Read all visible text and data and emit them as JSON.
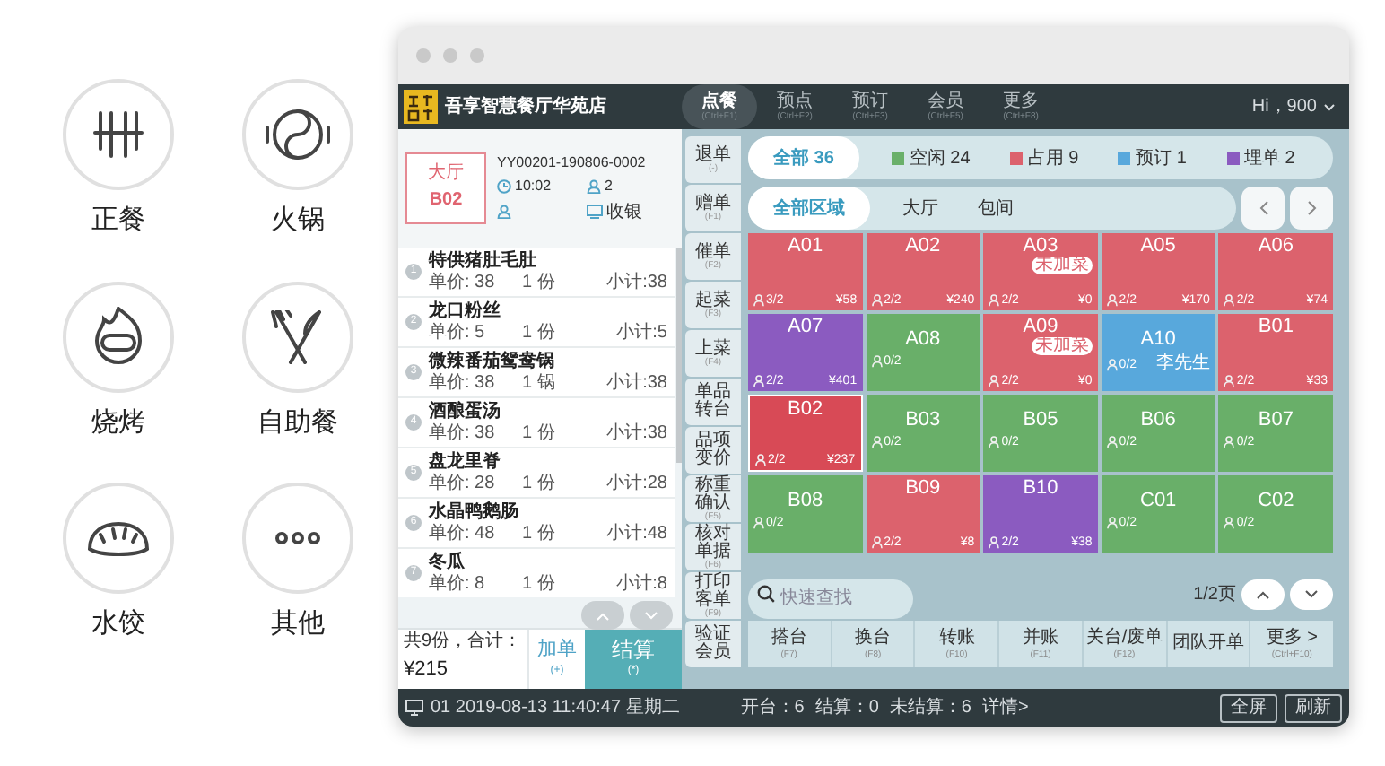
{
  "categories": [
    {
      "label": "正餐"
    },
    {
      "label": "火锅"
    },
    {
      "label": "烧烤"
    },
    {
      "label": "自助餐"
    },
    {
      "label": "水饺"
    },
    {
      "label": "其他"
    }
  ],
  "app": {
    "store_name": "吾享智慧餐厅华苑店",
    "nav": [
      {
        "label": "点餐",
        "shortcut": "(Ctrl+F1)",
        "selected": true
      },
      {
        "label": "预点",
        "shortcut": "(Ctrl+F2)",
        "selected": false
      },
      {
        "label": "预订",
        "shortcut": "(Ctrl+F3)",
        "selected": false
      },
      {
        "label": "会员",
        "shortcut": "(Ctrl+F5)",
        "selected": false
      },
      {
        "label": "更多",
        "shortcut": "(Ctrl+F8)",
        "selected": false
      }
    ],
    "user": "Hi，900",
    "order": {
      "area": "大厅",
      "table": "B02",
      "number": "YY00201-190806-0002",
      "time": "10:02",
      "guests": "2",
      "role": "收银",
      "items": [
        {
          "index": "1",
          "name": "特供猪肚毛肚",
          "price": "单价: 38",
          "qty": "1 份",
          "subtotal": "小计:38"
        },
        {
          "index": "2",
          "name": "龙口粉丝",
          "price": "单价: 5",
          "qty": "1 份",
          "subtotal": "小计:5"
        },
        {
          "index": "3",
          "name": "微辣番茄鸳鸯锅",
          "price": "单价: 38",
          "qty": "1 锅",
          "subtotal": "小计:38"
        },
        {
          "index": "4",
          "name": "酒酿蛋汤",
          "price": "单价: 38",
          "qty": "1 份",
          "subtotal": "小计:38"
        },
        {
          "index": "5",
          "name": "盘龙里脊",
          "price": "单价: 28",
          "qty": "1 份",
          "subtotal": "小计:28"
        },
        {
          "index": "6",
          "name": "水晶鸭鹅肠",
          "price": "单价: 48",
          "qty": "1 份",
          "subtotal": "小计:48"
        },
        {
          "index": "7",
          "name": "冬瓜",
          "price": "单价: 8",
          "qty": "1 份",
          "subtotal": "小计:8"
        }
      ],
      "summary_label": "共9份，合计：",
      "total": "¥215",
      "add_button": {
        "label": "加单",
        "key": "(+)"
      },
      "checkout_button": {
        "label": "结算",
        "key": "(*)"
      }
    },
    "side_buttons": [
      {
        "label": "退单",
        "key": "(-)"
      },
      {
        "label": "赠单",
        "key": "(F1)"
      },
      {
        "label": "催单",
        "key": "(F2)"
      },
      {
        "label": "起菜",
        "key": "(F3)"
      },
      {
        "label": "上菜",
        "key": "(F4)"
      },
      {
        "label": "单品转台"
      },
      {
        "label": "品项变价"
      },
      {
        "label": "称重确认",
        "key": "(F5)"
      },
      {
        "label": "核对单据",
        "key": "(F6)"
      },
      {
        "label": "打印客单",
        "key": "(F9)"
      },
      {
        "label": "验证会员"
      }
    ],
    "status_filters": [
      {
        "label": "全部 36",
        "selected": true
      },
      {
        "label": "空闲 24",
        "color": "#6ab06a",
        "selected": false
      },
      {
        "label": "占用 9",
        "color": "#dc626d",
        "selected": false
      },
      {
        "label": "预订 1",
        "color": "#58a8dc",
        "selected": false
      },
      {
        "label": "埋单 2",
        "color": "#8b5bc0",
        "selected": false
      }
    ],
    "area_filters": [
      {
        "label": "全部区域",
        "selected": true
      },
      {
        "label": "大厅",
        "selected": false
      },
      {
        "label": "包间",
        "selected": false
      }
    ],
    "tables": [
      {
        "name": "A01",
        "color": "#dc626d",
        "guests": "3/2",
        "amount": "¥58",
        "selected": false
      },
      {
        "name": "A02",
        "color": "#dc626d",
        "guests": "2/2",
        "amount": "¥240",
        "selected": false
      },
      {
        "name": "A03",
        "color": "#dc626d",
        "badge": "未加菜",
        "guests": "2/2",
        "amount": "¥0",
        "selected": false
      },
      {
        "name": "A05",
        "color": "#dc626d",
        "guests": "2/2",
        "amount": "¥170",
        "selected": false
      },
      {
        "name": "A06",
        "color": "#dc626d",
        "guests": "2/2",
        "amount": "¥74",
        "selected": false
      },
      {
        "name": "A07",
        "color": "#8b5bc0",
        "guests": "2/2",
        "amount": "¥401",
        "selected": false
      },
      {
        "name": "A08",
        "color": "#69af69",
        "guests": "0/2",
        "selected": false
      },
      {
        "name": "A09",
        "color": "#dc626d",
        "badge": "未加菜",
        "guests": "2/2",
        "amount": "¥0",
        "selected": false
      },
      {
        "name": "A10",
        "color": "#58a8dc",
        "guests": "0/2",
        "customer": "李先生",
        "selected": false
      },
      {
        "name": "B01",
        "color": "#dc626d",
        "guests": "2/2",
        "amount": "¥33",
        "selected": false
      },
      {
        "name": "B02",
        "color": "#d84a56",
        "guests": "2/2",
        "amount": "¥237",
        "selected": true
      },
      {
        "name": "B03",
        "color": "#69af69",
        "guests": "0/2",
        "selected": false
      },
      {
        "name": "B05",
        "color": "#69af69",
        "guests": "0/2",
        "selected": false
      },
      {
        "name": "B06",
        "color": "#69af69",
        "guests": "0/2",
        "selected": false
      },
      {
        "name": "B07",
        "color": "#69af69",
        "guests": "0/2",
        "selected": false
      },
      {
        "name": "B08",
        "color": "#69af69",
        "guests": "0/2",
        "selected": false
      },
      {
        "name": "B09",
        "color": "#dc626d",
        "guests": "2/2",
        "amount": "¥8",
        "selected": false
      },
      {
        "name": "B10",
        "color": "#8b5bc0",
        "guests": "2/2",
        "amount": "¥38",
        "selected": false
      },
      {
        "name": "C01",
        "color": "#69af69",
        "guests": "0/2",
        "selected": false
      },
      {
        "name": "C02",
        "color": "#69af69",
        "guests": "0/2",
        "selected": false
      }
    ],
    "search": {
      "placeholder": "快速查找"
    },
    "page": "1/2页",
    "actions": [
      {
        "label": "搭台",
        "key": "(F7)"
      },
      {
        "label": "换台",
        "key": "(F8)"
      },
      {
        "label": "转账",
        "key": "(F10)"
      },
      {
        "label": "并账",
        "key": "(F11)"
      },
      {
        "label": "关台/废单",
        "key": "(F12)"
      },
      {
        "label": "团队开单"
      },
      {
        "label": "更多 >",
        "key": "(Ctrl+F10)"
      }
    ],
    "status_bar": {
      "terminal": "01 2019-08-13 11:40:47 星期二",
      "stats": [
        "开台：6",
        "结算：0",
        "未结算：6"
      ],
      "details_link": "详情>",
      "buttons": [
        "全屏",
        "刷新"
      ]
    }
  }
}
